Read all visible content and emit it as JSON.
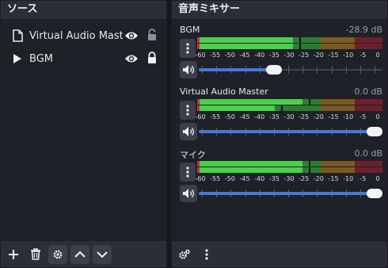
{
  "sources": {
    "title": "ソース",
    "items": [
      {
        "name": "Virtual Audio Master",
        "type": "file-icon",
        "visible": true,
        "locked": false
      },
      {
        "name": "BGM",
        "type": "play-icon",
        "visible": true,
        "locked": true
      }
    ],
    "toolbar": [
      "add-icon",
      "trash-icon",
      "gear-icon",
      "chevron-up-icon",
      "chevron-down-icon"
    ]
  },
  "mixer": {
    "title": "音声ミキサー",
    "scale": [
      "-60",
      "-55",
      "-50",
      "-45",
      "-40",
      "-35",
      "-30",
      "-25",
      "-20",
      "-15",
      "-10",
      "-5",
      "0"
    ],
    "channels": [
      {
        "name": "BGM",
        "db": "-28.9 dB",
        "level_db": [
          -29,
          -29
        ],
        "volume": 0.4
      },
      {
        "name": "Virtual Audio Master",
        "db": "0.0 dB",
        "level_db": [
          -26,
          -35
        ],
        "volume": 1.0
      },
      {
        "name": "マイク",
        "db": "0.0 dB",
        "level_db": [
          -26,
          -26
        ],
        "volume": 1.0
      }
    ],
    "toolbar": [
      "advanced-audio-gear-icon",
      "menu-dots-icon"
    ]
  },
  "colors": {
    "green": "#4bd04b",
    "green_dim": "#2c7d32",
    "yellow": "#c8962e",
    "yellow_dim": "#7a5a1e",
    "red": "#c03040",
    "red_dim": "#6e1f2a",
    "accent": "#4a78d6"
  }
}
